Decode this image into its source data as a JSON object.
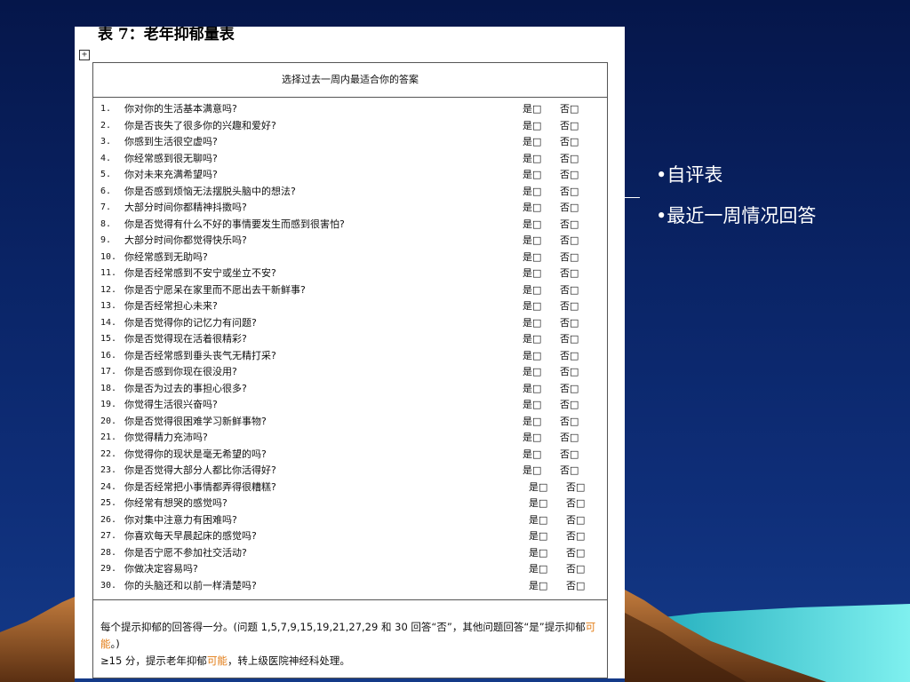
{
  "document": {
    "title": "表 7：老年抑郁量表",
    "anchor_icon": "table-move-handle-icon",
    "header": "选择过去一周内最适合你的答案",
    "yes_label": "是□",
    "no_label": "否□",
    "questions": [
      {
        "num": "1.",
        "text": "你对你的生活基本满意吗?"
      },
      {
        "num": "2.",
        "text": "你是否丧失了很多你的兴趣和爱好?"
      },
      {
        "num": "3.",
        "text": "你感到生活很空虚吗?"
      },
      {
        "num": "4.",
        "text": "你经常感到很无聊吗?"
      },
      {
        "num": "5.",
        "text": "你对未来充满希望吗?"
      },
      {
        "num": "6.",
        "text": "你是否感到烦恼无法摆脱头脑中的想法?"
      },
      {
        "num": "7.",
        "text": "大部分时间你都精神抖擞吗?"
      },
      {
        "num": "8.",
        "text": "你是否觉得有什么不好的事情要发生而感到很害怕?"
      },
      {
        "num": "9.",
        "text": "大部分时间你都觉得快乐吗?"
      },
      {
        "num": "10.",
        "text": "你经常感到无助吗?"
      },
      {
        "num": "11.",
        "text": "你是否经常感到不安宁或坐立不安?"
      },
      {
        "num": "12.",
        "text": "你是否宁愿呆在家里而不愿出去干新鲜事?"
      },
      {
        "num": "13.",
        "text": "你是否经常担心未来?"
      },
      {
        "num": "14.",
        "text": "你是否觉得你的记忆力有问题?"
      },
      {
        "num": "15.",
        "text": "你是否觉得现在活着很精彩?"
      },
      {
        "num": "16.",
        "text": "你是否经常感到垂头丧气无精打采?"
      },
      {
        "num": "17.",
        "text": "你是否感到你现在很没用?"
      },
      {
        "num": "18.",
        "text": "你是否为过去的事担心很多?"
      },
      {
        "num": "19.",
        "text": "你觉得生活很兴奋吗?"
      },
      {
        "num": "20.",
        "text": "你是否觉得很困难学习新鲜事物?"
      },
      {
        "num": "21.",
        "text": "你觉得精力充沛吗?"
      },
      {
        "num": "22.",
        "text": "你觉得你的现状是毫无希望的吗?"
      },
      {
        "num": "23.",
        "text": "你是否觉得大部分人都比你活得好?"
      },
      {
        "num": "24.",
        "text": "你是否经常把小事情都弄得很糟糕?"
      },
      {
        "num": "25.",
        "text": "你经常有想哭的感觉吗?"
      },
      {
        "num": "26.",
        "text": "你对集中注意力有困难吗?"
      },
      {
        "num": "27.",
        "text": "你喜欢每天早晨起床的感觉吗?"
      },
      {
        "num": "28.",
        "text": "你是否宁愿不参加社交活动?"
      },
      {
        "num": "29.",
        "text": "你做决定容易吗?"
      },
      {
        "num": "30.",
        "text": "你的头脑还和以前一样清楚吗?"
      }
    ],
    "footer": {
      "line1_a": "每个提示抑郁的回答得一分。(问题 1,5,7,9,15,19,21,27,29 和 30 回答“否”，其他问题回答“是”提示抑郁",
      "line1_hl": "可能",
      "line1_b": "。)",
      "line2_a": "≥15 分，提示老年抑郁",
      "line2_hl": "可能",
      "line2_b": "，转上级医院神经科处理。"
    },
    "highlight_color": "#e27a12"
  },
  "bullets": [
    "•自评表",
    "•最近一周情况回答"
  ],
  "colors": {
    "background": "#0a2466",
    "bullet_text": "#ffffff"
  }
}
